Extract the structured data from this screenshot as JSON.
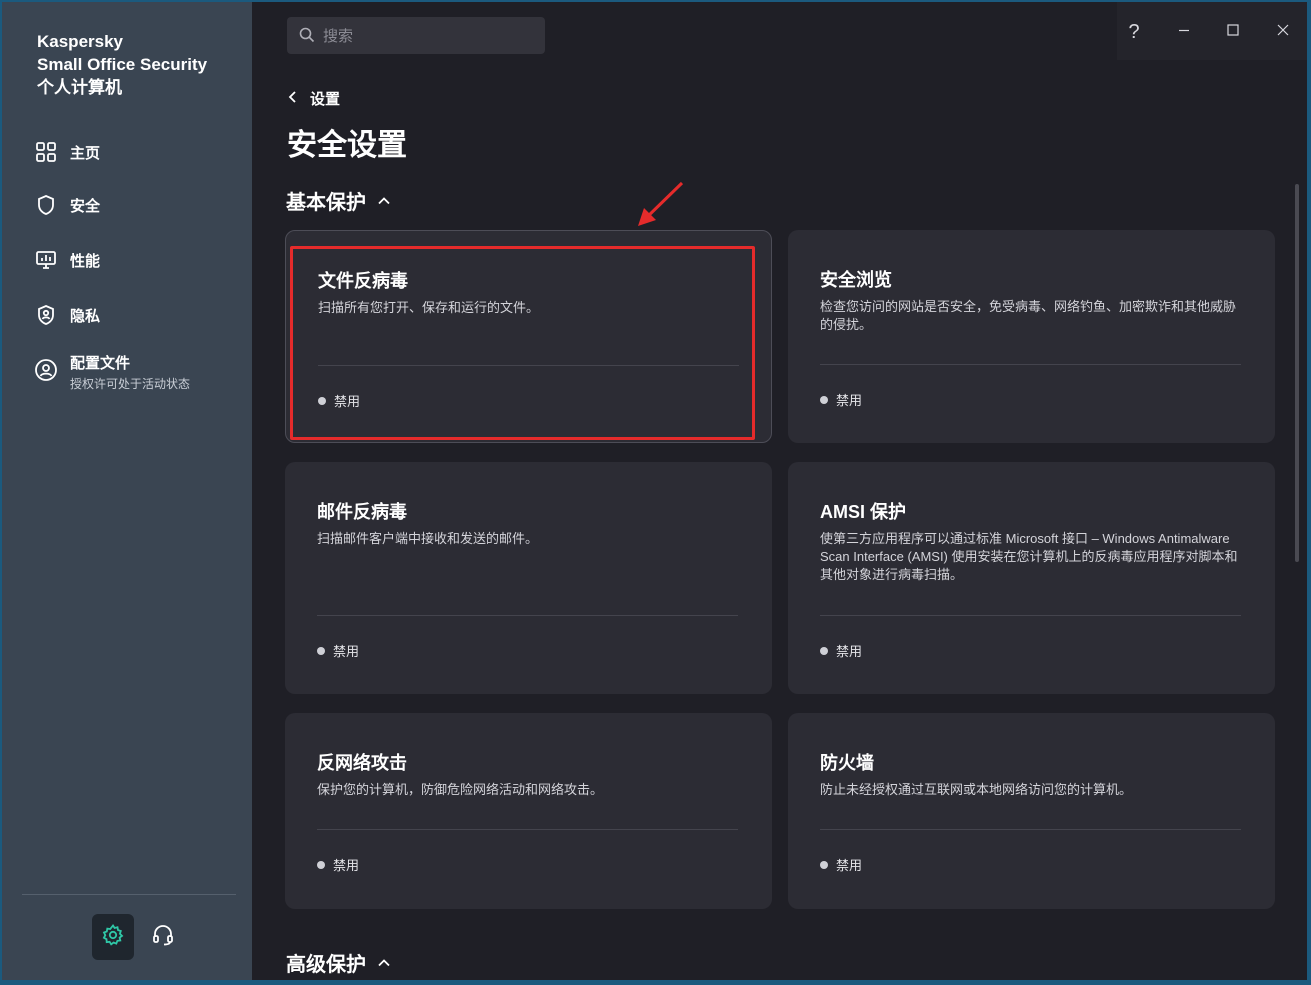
{
  "sidebar": {
    "brand_line1": "Kaspersky",
    "brand_line2": "Small Office Security",
    "brand_line3": "个人计算机",
    "items": [
      {
        "label": "主页",
        "icon": "grid-icon"
      },
      {
        "label": "安全",
        "icon": "shield-icon"
      },
      {
        "label": "性能",
        "icon": "monitor-chart-icon"
      },
      {
        "label": "隐私",
        "icon": "shield-person-icon"
      },
      {
        "label": "配置文件",
        "sublabel": "授权许可处于活动状态",
        "icon": "user-circle-icon"
      }
    ],
    "settings_icon": "gear-icon",
    "support_icon": "headset-icon"
  },
  "topbar": {
    "search_placeholder": "搜索",
    "help": "?"
  },
  "header": {
    "back_label": "设置",
    "title": "安全设置"
  },
  "sections": {
    "basic": "基本保护",
    "advanced": "高级保护"
  },
  "cards": [
    {
      "title": "文件反病毒",
      "desc": "扫描所有您打开、保存和运行的文件。",
      "status": "禁用"
    },
    {
      "title": "安全浏览",
      "desc": "检查您访问的网站是否安全，免受病毒、网络钓鱼、加密欺诈和其他威胁的侵扰。",
      "status": "禁用"
    },
    {
      "title": "邮件反病毒",
      "desc": "扫描邮件客户端中接收和发送的邮件。",
      "status": "禁用"
    },
    {
      "title": "AMSI 保护",
      "desc": "使第三方应用程序可以通过标准 Microsoft 接口 – Windows Antimalware Scan Interface (AMSI) 使用安装在您计算机上的反病毒应用程序对脚本和其他对象进行病毒扫描。",
      "status": "禁用"
    },
    {
      "title": "反网络攻击",
      "desc": "保护您的计算机，防御危险网络活动和网络攻击。",
      "status": "禁用"
    },
    {
      "title": "防火墙",
      "desc": "防止未经授权通过互联网或本地网络访问您的计算机。",
      "status": "禁用"
    }
  ],
  "colors": {
    "sidebar_bg": "#3a4552",
    "content_bg": "#1f1f26",
    "card_bg": "#2c2c34",
    "accent_teal": "#2fc8a7",
    "annotation_red": "#e52b2b"
  }
}
